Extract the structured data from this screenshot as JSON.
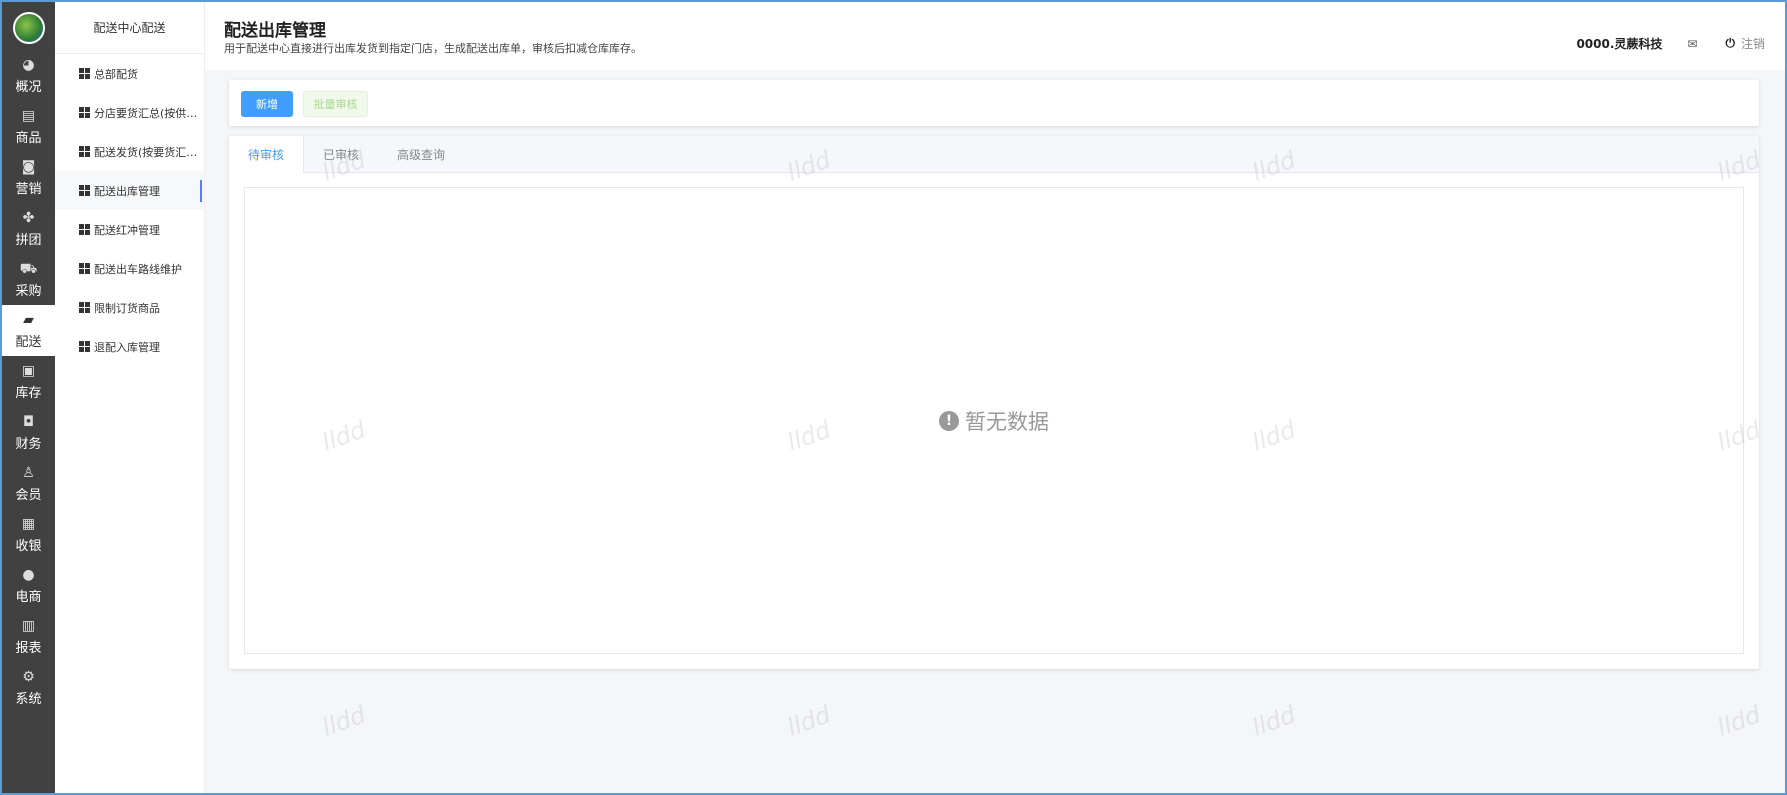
{
  "nav": [
    {
      "icon": "dashboard-icon",
      "glyph": "◕",
      "label": "概况"
    },
    {
      "icon": "document-icon",
      "glyph": "▤",
      "label": "商品"
    },
    {
      "icon": "tag-icon",
      "glyph": "◙",
      "label": "营销"
    },
    {
      "icon": "clover-icon",
      "glyph": "✤",
      "label": "拼团"
    },
    {
      "icon": "cart-icon",
      "glyph": "⛟",
      "label": "采购"
    },
    {
      "icon": "truck-icon",
      "glyph": "▰",
      "label": "配送"
    },
    {
      "icon": "box-icon",
      "glyph": "▣",
      "label": "库存"
    },
    {
      "icon": "wallet-icon",
      "glyph": "◘",
      "label": "财务"
    },
    {
      "icon": "user-icon",
      "glyph": "♙",
      "label": "会员"
    },
    {
      "icon": "cash-register-icon",
      "glyph": "▦",
      "label": "收银"
    },
    {
      "icon": "person-icon",
      "glyph": "●",
      "label": "电商"
    },
    {
      "icon": "report-icon",
      "glyph": "▥",
      "label": "报表"
    },
    {
      "icon": "settings-icon",
      "glyph": "⚙",
      "label": "系统"
    }
  ],
  "sub": {
    "title": "配送中心配送",
    "items": [
      "总部配货",
      "分店要货汇总(按供应商)",
      "配送发货(按要货汇总)",
      "配送出库管理",
      "配送红冲管理",
      "配送出车路线维护",
      "限制订货商品",
      "退配入库管理"
    ]
  },
  "header": {
    "title": "配送出库管理",
    "desc": "用于配送中心直接进行出库发货到指定门店，生成配送出库单，审核后扣减仓库库存。",
    "company": "0000.灵蕨科技",
    "logout": "注销"
  },
  "toolbar": {
    "add": "新增",
    "batch_audit": "批量审核"
  },
  "tabs": [
    "待审核",
    "已审核",
    "高级查询"
  ],
  "empty": "暂无数据",
  "watermark": "lldd"
}
